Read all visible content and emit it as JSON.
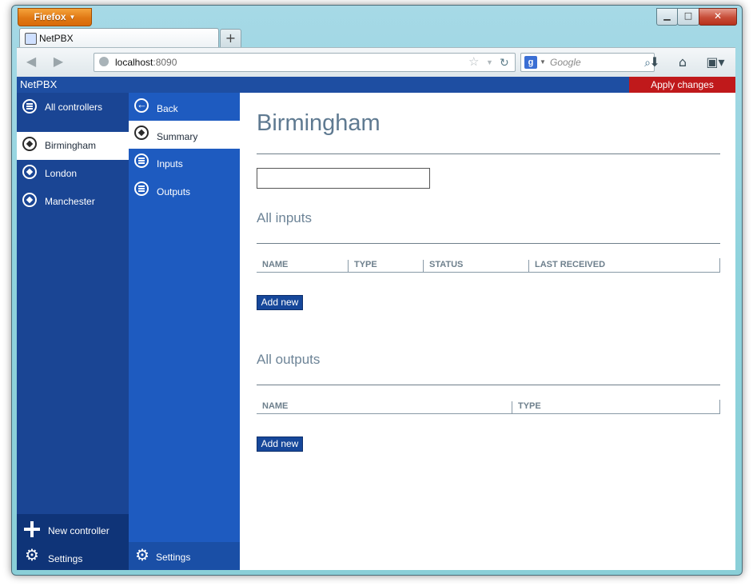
{
  "browser": {
    "menu_button": "Firefox",
    "tab_title": "NetPBX",
    "url_host": "localhost",
    "url_port": ":8090",
    "search_placeholder": "Google"
  },
  "app": {
    "title": "NetPBX",
    "apply_label": "Apply changes"
  },
  "sidebar": {
    "all_controllers": "All controllers",
    "controllers": [
      "Birmingham",
      "London",
      "Manchester"
    ],
    "active_controller": "Birmingham",
    "new_controller": "New controller",
    "settings": "Settings"
  },
  "subnav": {
    "back": "Back",
    "summary": "Summary",
    "inputs": "Inputs",
    "outputs": "Outputs",
    "settings": "Settings"
  },
  "main": {
    "title": "Birmingham",
    "name_value": "",
    "inputs_heading": "All inputs",
    "inputs_columns": [
      "NAME",
      "TYPE",
      "STATUS",
      "LAST RECEIVED"
    ],
    "outputs_heading": "All outputs",
    "outputs_columns": [
      "NAME",
      "TYPE"
    ],
    "add_new": "Add new"
  },
  "colors": {
    "header_blue": "#1e4ea2",
    "apply_red": "#c0191b",
    "sidebar_dark": "#1a4594",
    "sidebar_mid": "#1e5bc0"
  }
}
